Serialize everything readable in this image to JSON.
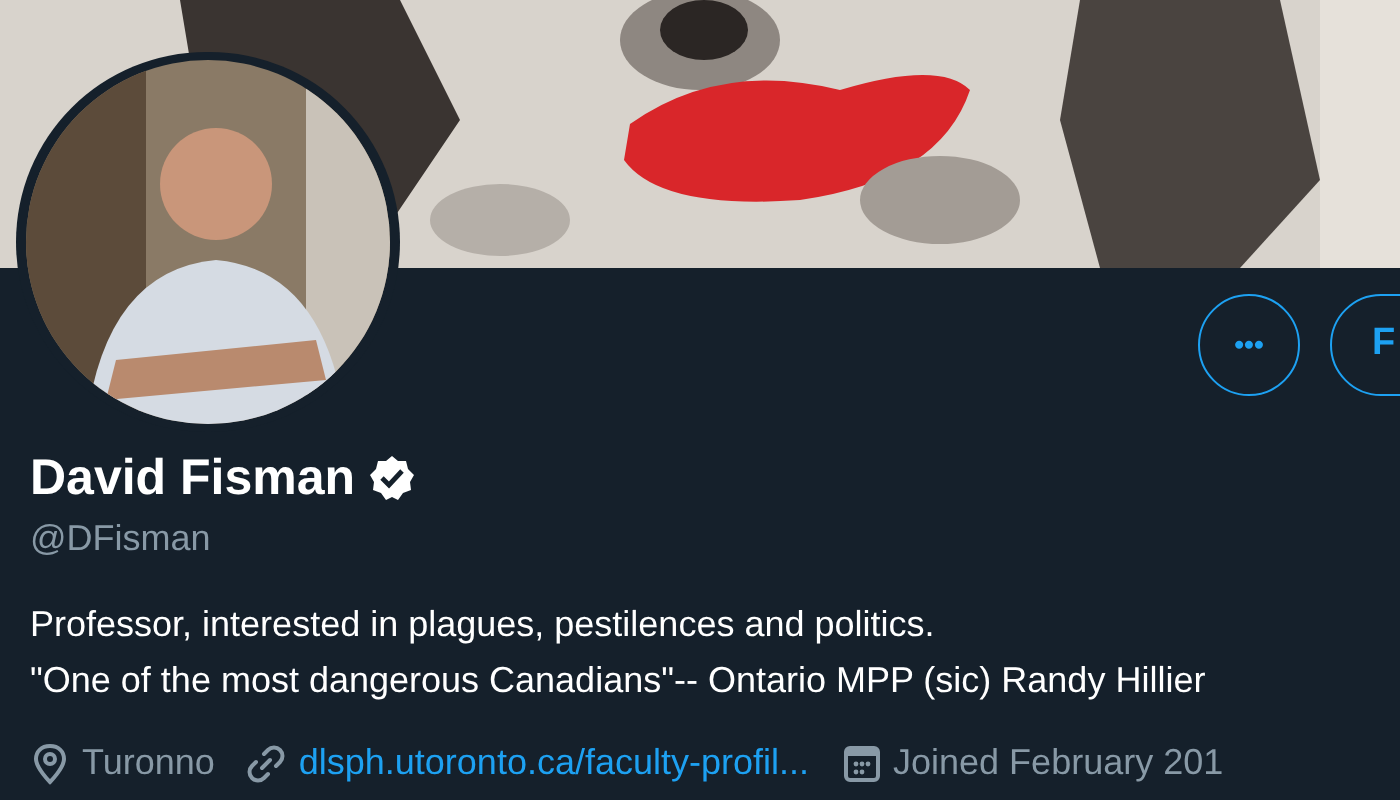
{
  "actions": {
    "more": "•••",
    "follow": "F"
  },
  "profile": {
    "name": "David Fisman",
    "verified": true,
    "handle": "@DFisman",
    "bio": [
      "Professor, interested in plagues, pestilences and politics.",
      "\"One of the most dangerous Canadians\"-- Ontario MPP (sic) Randy Hillier"
    ],
    "meta": [
      {
        "kind": "location",
        "text": "Turonno"
      },
      {
        "kind": "link",
        "text": "dlsph.utoronto.ca/faculty-profil..."
      },
      {
        "kind": "joined",
        "text": "Joined February 201"
      }
    ]
  }
}
